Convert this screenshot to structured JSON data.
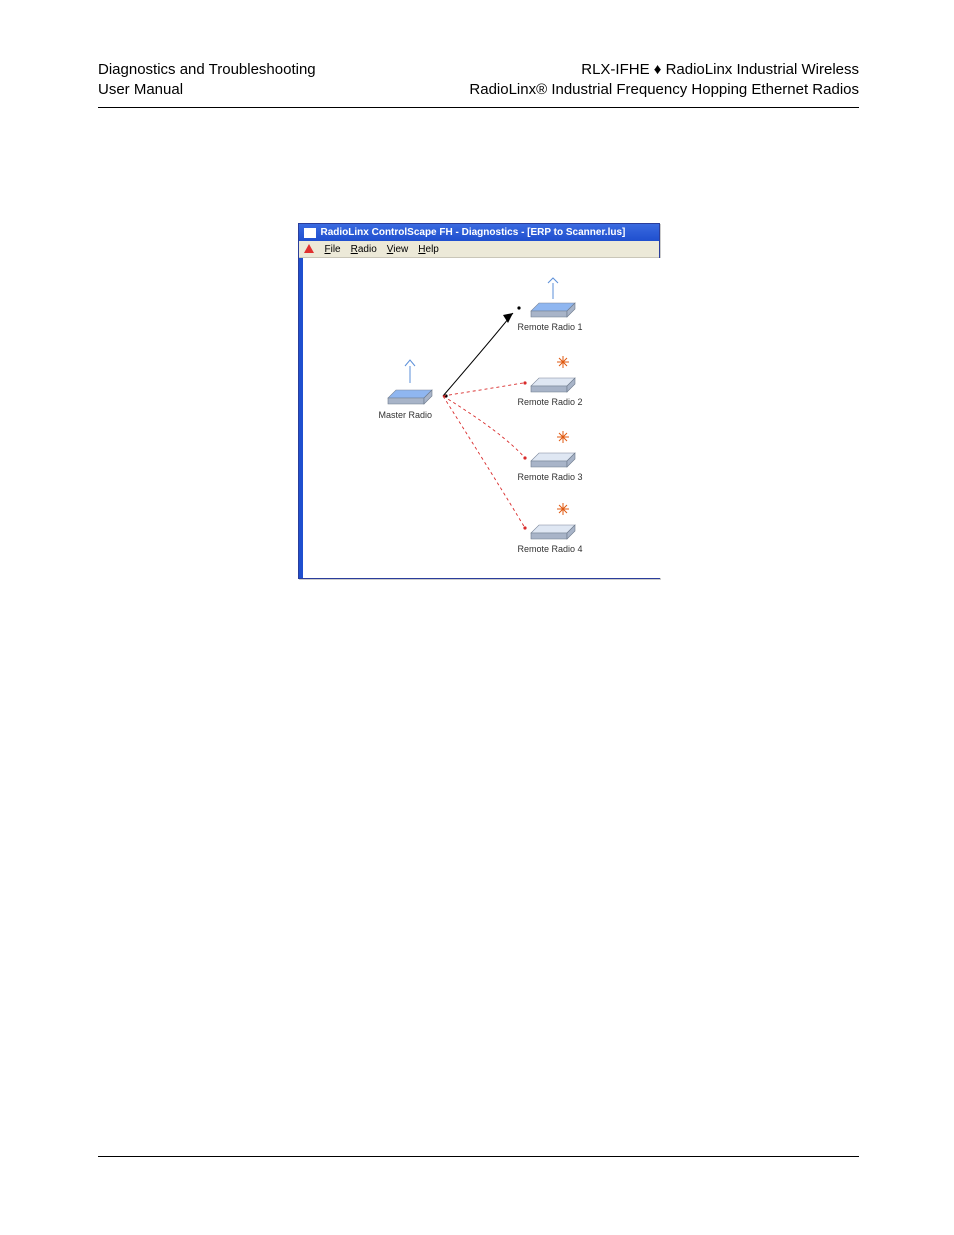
{
  "header": {
    "left_line1": "Diagnostics and Troubleshooting",
    "left_line2": "User Manual",
    "right_line1": "RLX-IFHE ♦ RadioLinx Industrial Wireless",
    "right_line2": "RadioLinx® Industrial Frequency Hopping Ethernet Radios"
  },
  "app_window": {
    "title": "RadioLinx ControlScape FH - Diagnostics - [ERP to Scanner.lus]",
    "menus": {
      "file": "File",
      "radio": "Radio",
      "view": "View",
      "help": "Help"
    },
    "nodes": {
      "master": "Master Radio",
      "remote1": "Remote Radio 1",
      "remote2": "Remote Radio 2",
      "remote3": "Remote Radio 3",
      "remote4": "Remote Radio 4"
    }
  }
}
